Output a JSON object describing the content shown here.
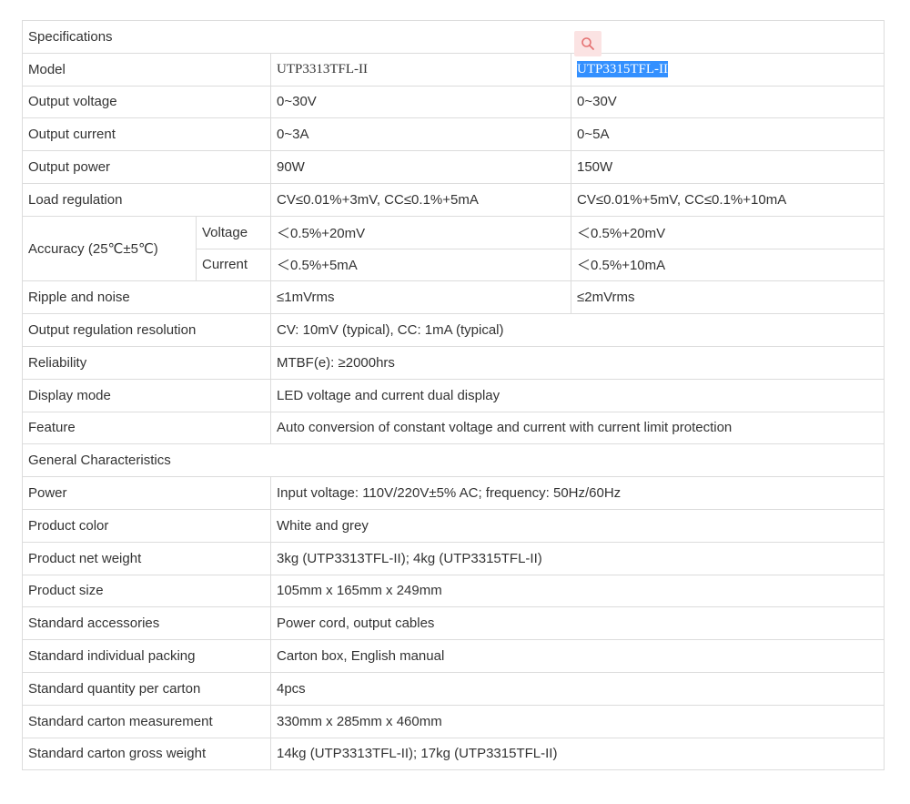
{
  "specifications": {
    "header": "Specifications",
    "model": {
      "label": "Model",
      "a": "UTP3313TFL-II",
      "b": "UTP3315TFL-II"
    },
    "rows_two_col": [
      {
        "label": "Output voltage",
        "a": "0~30V",
        "b": "0~30V"
      },
      {
        "label": "Output current",
        "a": "0~3A",
        "b": "0~5A"
      },
      {
        "label": "Output power",
        "a": "90W",
        "b": "150W"
      },
      {
        "label": "Load regulation",
        "a": "CV≤0.01%+3mV, CC≤0.1%+5mA",
        "b": "CV≤0.01%+5mV, CC≤0.1%+10mA"
      }
    ],
    "accuracy": {
      "label": "Accuracy (25℃±5℃)",
      "voltage": {
        "label": "Voltage",
        "a": "＜0.5%+20mV",
        "b": "＜0.5%+20mV"
      },
      "current": {
        "label": "Current",
        "a": "＜0.5%+5mA",
        "b": "＜0.5%+10mA"
      }
    },
    "ripple": {
      "label": "Ripple and noise",
      "a": "≤1mVrms",
      "b": "≤2mVrms"
    },
    "rows_single": [
      {
        "label": "Output regulation resolution",
        "value": "CV: 10mV (typical), CC: 1mA (typical)"
      },
      {
        "label": "Reliability",
        "value": "MTBF(e): ≥2000hrs"
      },
      {
        "label": "Display mode",
        "value": "LED voltage and current dual display"
      },
      {
        "label": "Feature",
        "value": "Auto conversion of constant voltage and current with current limit protection"
      }
    ]
  },
  "general": {
    "header": "General Characteristics",
    "rows": [
      {
        "label": "Power",
        "value": "Input voltage: 110V/220V±5% AC; frequency: 50Hz/60Hz"
      },
      {
        "label": "Product color",
        "value": "White and grey"
      },
      {
        "label": "Product net weight",
        "value": "3kg (UTP3313TFL-II); 4kg (UTP3315TFL-II)"
      },
      {
        "label": "Product size",
        "value": "105mm x 165mm x 249mm"
      },
      {
        "label": "Standard accessories",
        "value": "Power cord, output cables"
      },
      {
        "label": "Standard individual packing",
        "value": "Carton box, English manual"
      },
      {
        "label": "Standard quantity per carton",
        "value": "4pcs"
      },
      {
        "label": "Standard carton measurement",
        "value": "330mm x 285mm x 460mm"
      },
      {
        "label": "Standard carton gross weight",
        "value": "14kg (UTP3313TFL-II); 17kg (UTP3315TFL-II)"
      }
    ]
  },
  "selection_popup": {
    "icon": "search-icon",
    "color": "#e57373"
  },
  "colors": {
    "selection": "#3390ff",
    "border": "#dcdcdc",
    "text": "#333333"
  }
}
